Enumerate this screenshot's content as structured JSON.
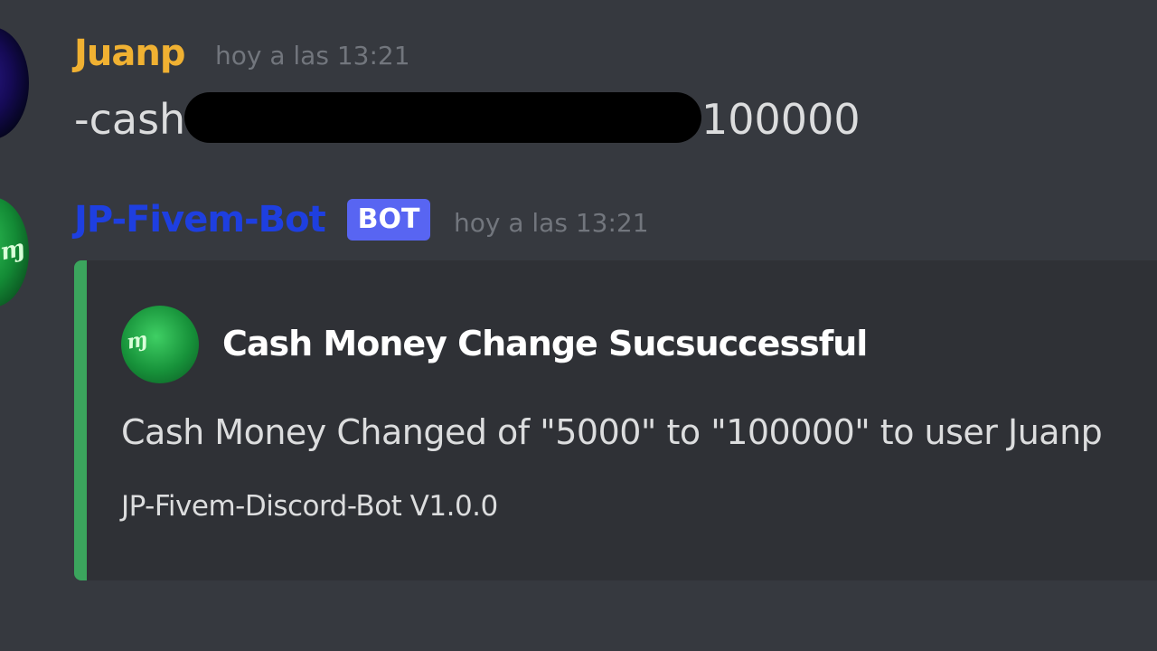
{
  "messages": [
    {
      "author": "Juanp",
      "timestamp": "hoy a las 13:21",
      "command": "-cash",
      "amount": "100000"
    },
    {
      "author": "JP-Fivem-Bot",
      "badge": "BOT",
      "timestamp": "hoy a las 13:21",
      "embed": {
        "accent_color": "#3ba55d",
        "icon": "fivem-logo-icon",
        "title": "Cash Money Change Sucsuccessful",
        "description": "Cash Money Changed of \"5000\" to \"100000\" to user Juanp",
        "footer": "JP-Fivem-Discord-Bot V1.0.0"
      }
    }
  ],
  "colors": {
    "background": "#36393f",
    "user_name": "#f0b132",
    "bot_name": "#1e3fe0",
    "bot_badge": "#5865f2",
    "embed_bg": "#2f3136"
  }
}
